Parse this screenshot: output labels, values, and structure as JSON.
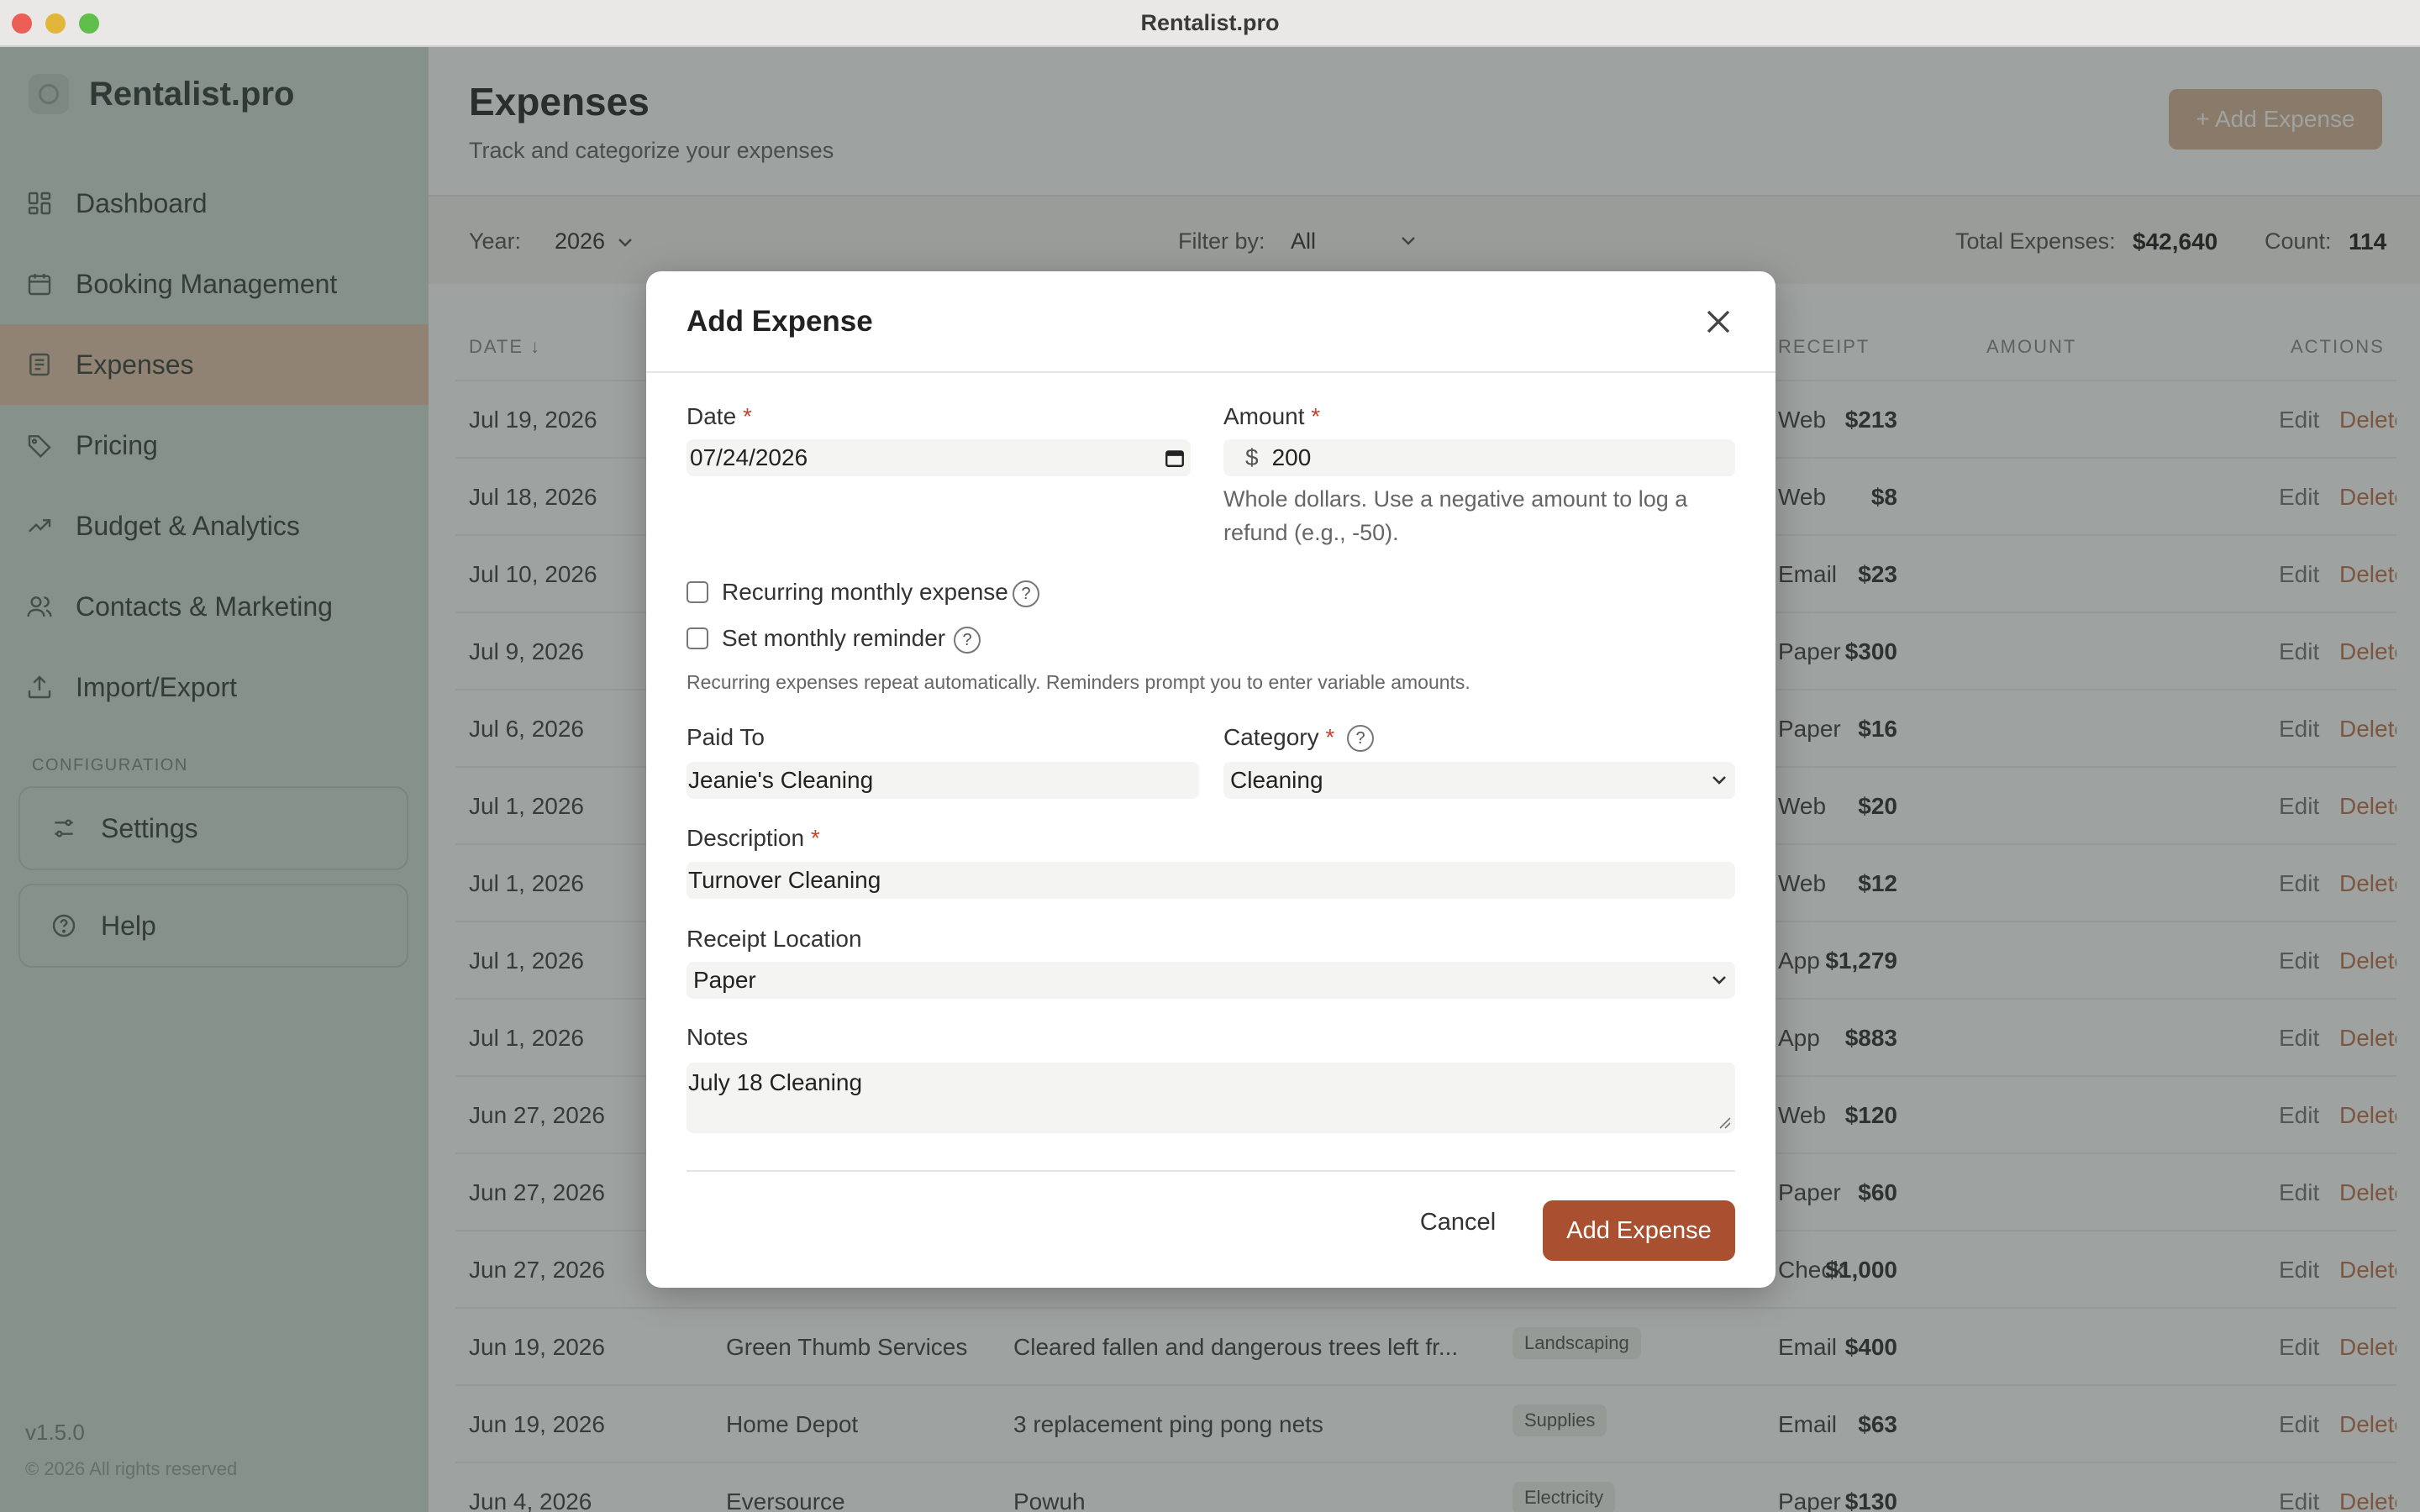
{
  "window": {
    "title": "Rentalist.pro"
  },
  "sidebar": {
    "brand": "Rentalist.pro",
    "items": [
      {
        "label": "Dashboard",
        "icon": "dashboard-icon"
      },
      {
        "label": "Booking Management",
        "icon": "calendar-icon"
      },
      {
        "label": "Expenses",
        "icon": "receipt-icon",
        "active": true
      },
      {
        "label": "Pricing",
        "icon": "tag-icon"
      },
      {
        "label": "Budget & Analytics",
        "icon": "trend-icon"
      },
      {
        "label": "Contacts & Marketing",
        "icon": "users-icon"
      },
      {
        "label": "Import/Export",
        "icon": "upload-icon"
      }
    ],
    "section_label": "CONFIGURATION",
    "settings_label": "Settings",
    "help_label": "Help",
    "version": "v1.5.0",
    "copyright": "© 2026 All rights reserved"
  },
  "header": {
    "title": "Expenses",
    "subtitle": "Track and categorize your expenses",
    "add_button": "+ Add Expense"
  },
  "filters": {
    "year_label": "Year:",
    "year_value": "2026",
    "filter_label": "Filter by:",
    "filter_value": "All",
    "total_label": "Total Expenses:",
    "total_value": "$42,640",
    "count_label": "Count:",
    "count_value": "114"
  },
  "table": {
    "headers": {
      "date": "DATE ↓",
      "receipt": "RECEIPT",
      "amount": "AMOUNT",
      "actions": "ACTIONS"
    },
    "edit_label": "Edit",
    "delete_label": "Delete",
    "rows": [
      {
        "date": "Jul 19, 2026",
        "paid_to": "",
        "description": "",
        "category": "",
        "receipt": "Web",
        "amount": "$213"
      },
      {
        "date": "Jul 18, 2026",
        "paid_to": "",
        "description": "",
        "category": "",
        "receipt": "Web",
        "amount": "$8"
      },
      {
        "date": "Jul 10, 2026",
        "paid_to": "",
        "description": "",
        "category": "",
        "receipt": "Email",
        "amount": "$23"
      },
      {
        "date": "Jul 9, 2026",
        "paid_to": "",
        "description": "",
        "category": "",
        "receipt": "Paper",
        "amount": "$300"
      },
      {
        "date": "Jul 6, 2026",
        "paid_to": "",
        "description": "",
        "category": "",
        "receipt": "Paper",
        "amount": "$16"
      },
      {
        "date": "Jul 1, 2026",
        "paid_to": "",
        "description": "",
        "category": "",
        "receipt": "Web",
        "amount": "$20"
      },
      {
        "date": "Jul 1, 2026",
        "paid_to": "",
        "description": "",
        "category": "",
        "receipt": "Web",
        "amount": "$12"
      },
      {
        "date": "Jul 1, 2026",
        "paid_to": "",
        "description": "",
        "category": "",
        "receipt": "App",
        "amount": "$1,279"
      },
      {
        "date": "Jul 1, 2026",
        "paid_to": "",
        "description": "",
        "category": "",
        "receipt": "App",
        "amount": "$883"
      },
      {
        "date": "Jun 27, 2026",
        "paid_to": "",
        "description": "",
        "category": "",
        "receipt": "Web",
        "amount": "$120"
      },
      {
        "date": "Jun 27, 2026",
        "paid_to": "",
        "description": "",
        "category": "",
        "receipt": "Paper",
        "amount": "$60"
      },
      {
        "date": "Jun 27, 2026",
        "paid_to": "",
        "description": "",
        "category": "",
        "receipt": "Check",
        "amount": "$1,000"
      },
      {
        "date": "Jun 19, 2026",
        "paid_to": "Green Thumb Services",
        "description": "Cleared fallen and dangerous trees left fr...",
        "category": "Landscaping",
        "receipt": "Email",
        "amount": "$400"
      },
      {
        "date": "Jun 19, 2026",
        "paid_to": "Home Depot",
        "description": "3 replacement ping pong nets",
        "category": "Supplies",
        "receipt": "Email",
        "amount": "$63"
      },
      {
        "date": "Jun 4, 2026",
        "paid_to": "Eversource",
        "description": "Powuh",
        "category": "Electricity",
        "receipt": "Paper",
        "amount": "$130"
      }
    ]
  },
  "modal": {
    "title": "Add Expense",
    "date_label": "Date",
    "date_value": "07/24/2026",
    "amount_label": "Amount",
    "currency_symbol": "$",
    "amount_value": "200",
    "amount_hint": "Whole dollars. Use a negative amount to log a refund (e.g., -50).",
    "recurring_label": "Recurring monthly expense",
    "reminder_label": "Set monthly reminder",
    "recurring_hint": "Recurring expenses repeat automatically. Reminders prompt you to enter variable amounts.",
    "paid_to_label": "Paid To",
    "paid_to_value": "Jeanie's Cleaning",
    "category_label": "Category",
    "category_value": "Cleaning",
    "description_label": "Description",
    "description_value": "Turnover Cleaning",
    "receipt_label": "Receipt Location",
    "receipt_value": "Paper",
    "notes_label": "Notes",
    "notes_value": "July 18 Cleaning",
    "required_mark": "*",
    "help_mark": "?",
    "cancel_label": "Cancel",
    "submit_label": "Add Expense"
  },
  "colors": {
    "accent": "#a85030",
    "sidebar_bg": "#d4e0da",
    "active_nav": "#e7c7ae",
    "delete_text": "#c27550"
  }
}
